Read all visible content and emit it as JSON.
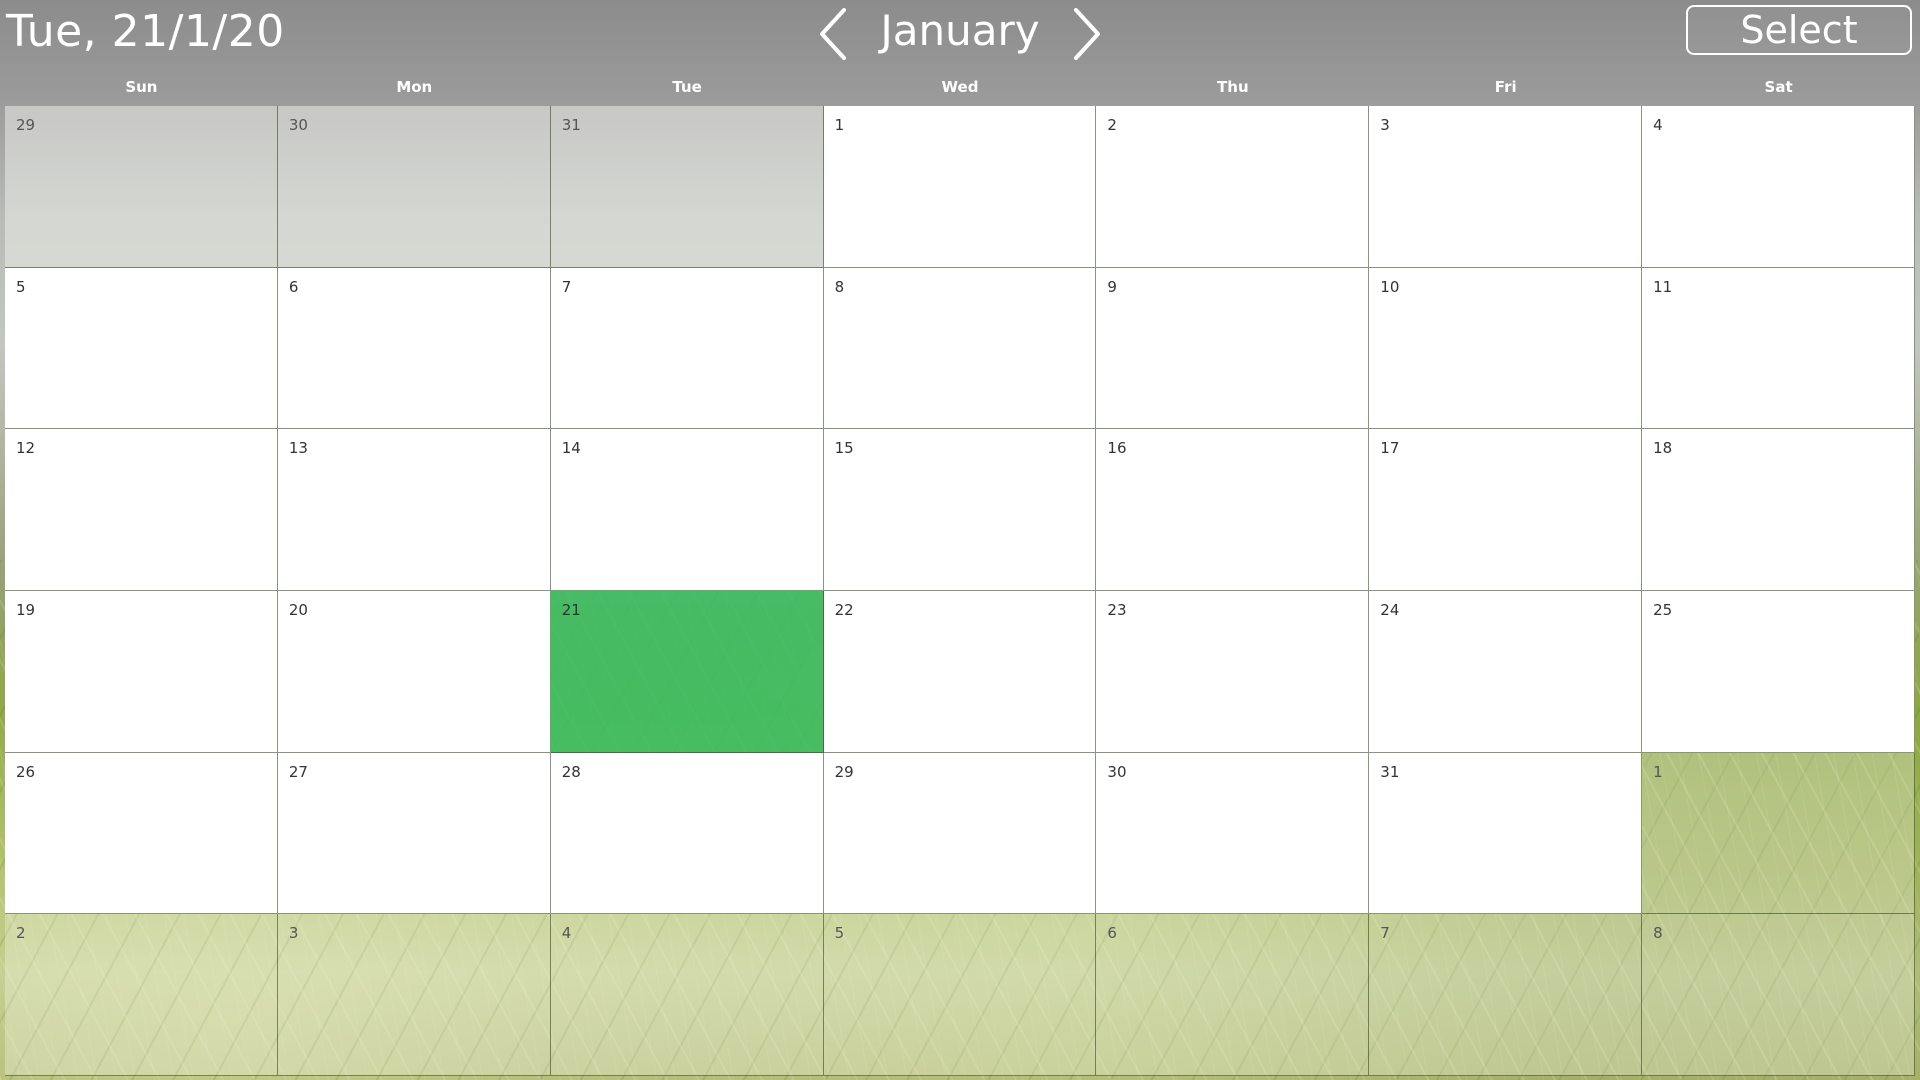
{
  "header": {
    "current_date": "Tue, 21/1/20",
    "month": "January",
    "prev_icon": "chevron-left-icon",
    "next_icon": "chevron-right-icon",
    "select_label": "Select"
  },
  "weekdays": [
    "Sun",
    "Mon",
    "Tue",
    "Wed",
    "Thu",
    "Fri",
    "Sat"
  ],
  "selected_day": "21",
  "selected_color": "#3cbe64",
  "weeks": [
    [
      "29",
      "30",
      "31",
      "1",
      "2",
      "3",
      "4"
    ],
    [
      "5",
      "6",
      "7",
      "8",
      "9",
      "10",
      "11"
    ],
    [
      "12",
      "13",
      "14",
      "15",
      "16",
      "17",
      "18"
    ],
    [
      "19",
      "20",
      "21",
      "22",
      "23",
      "24",
      "25"
    ],
    [
      "26",
      "27",
      "28",
      "29",
      "30",
      "31",
      "1"
    ],
    [
      "2",
      "3",
      "4",
      "5",
      "6",
      "7",
      "8"
    ]
  ]
}
